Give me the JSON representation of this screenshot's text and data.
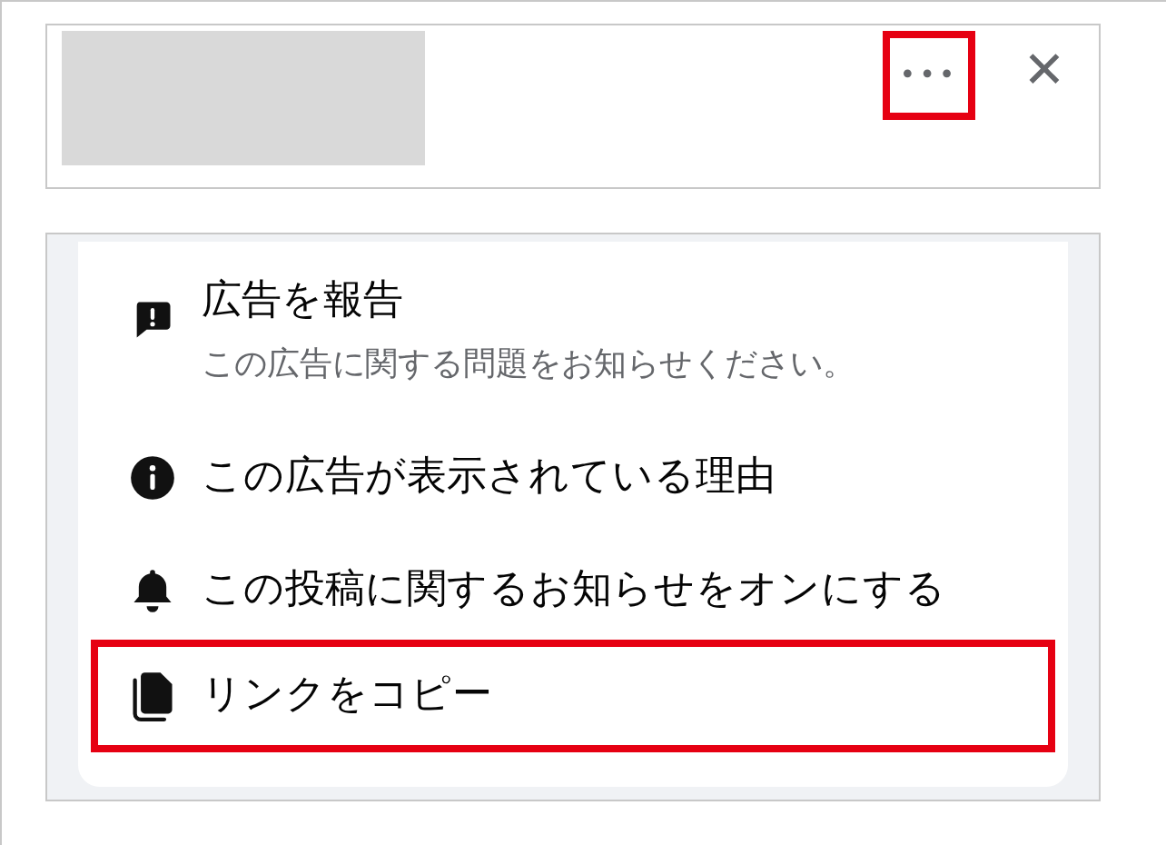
{
  "header": {
    "more_button": {
      "label": "•••",
      "highlighted": true
    },
    "close_button": {
      "label": "✕"
    }
  },
  "menu": {
    "items": [
      {
        "kind": "report",
        "title": "広告を報告",
        "subtitle": "この広告に関する問題をお知らせください。",
        "highlighted": false
      },
      {
        "kind": "info",
        "title": "この広告が表示されている理由",
        "highlighted": false
      },
      {
        "kind": "bell",
        "title": "この投稿に関するお知らせをオンにする",
        "highlighted": false
      },
      {
        "kind": "copy",
        "title": "リンクをコピー",
        "highlighted": true
      }
    ]
  }
}
